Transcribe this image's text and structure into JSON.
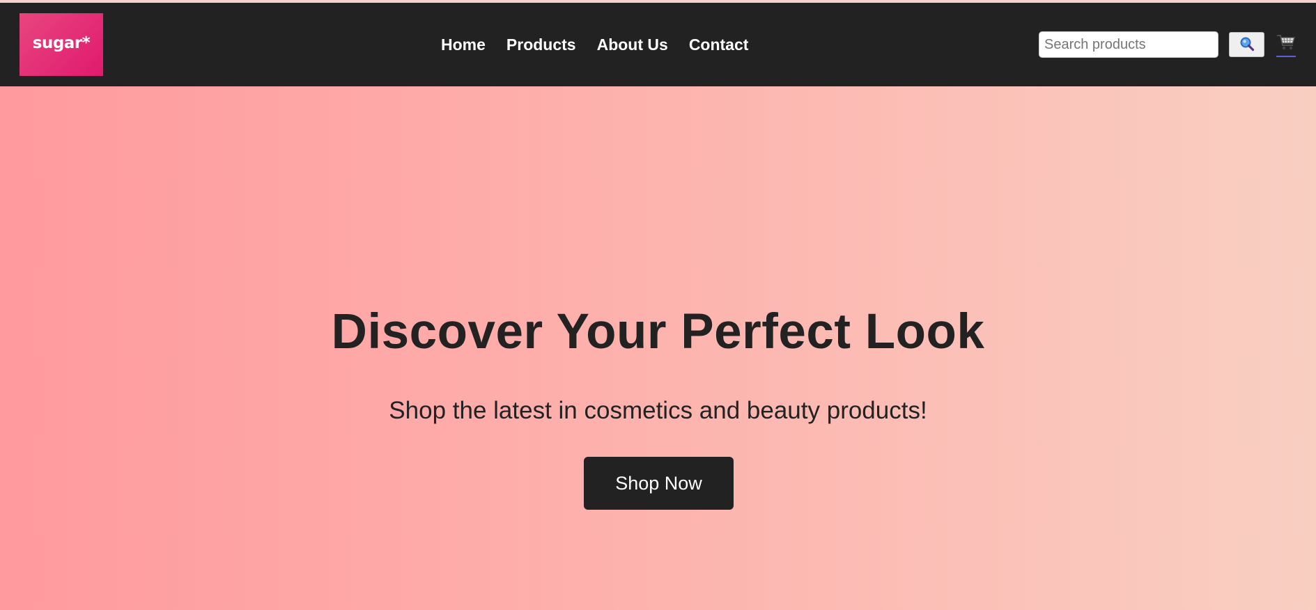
{
  "header": {
    "logo_text": "sugar*",
    "nav": [
      {
        "label": "Home"
      },
      {
        "label": "Products"
      },
      {
        "label": "About Us"
      },
      {
        "label": "Contact"
      }
    ],
    "search": {
      "placeholder": "Search products",
      "value": ""
    },
    "search_button_icon": "magnifier-icon",
    "cart_icon": "shopping-cart-icon"
  },
  "hero": {
    "title": "Discover Your Perfect Look",
    "subtitle": "Shop the latest in cosmetics and beauty products!",
    "cta_label": "Shop Now"
  },
  "colors": {
    "navbar_bg": "#222222",
    "logo_bg": "#e0266f",
    "hero_gradient_start": "#ff9a9e",
    "hero_gradient_end": "#f9cfc2",
    "cta_bg": "#222222",
    "text_dark": "#222222"
  }
}
